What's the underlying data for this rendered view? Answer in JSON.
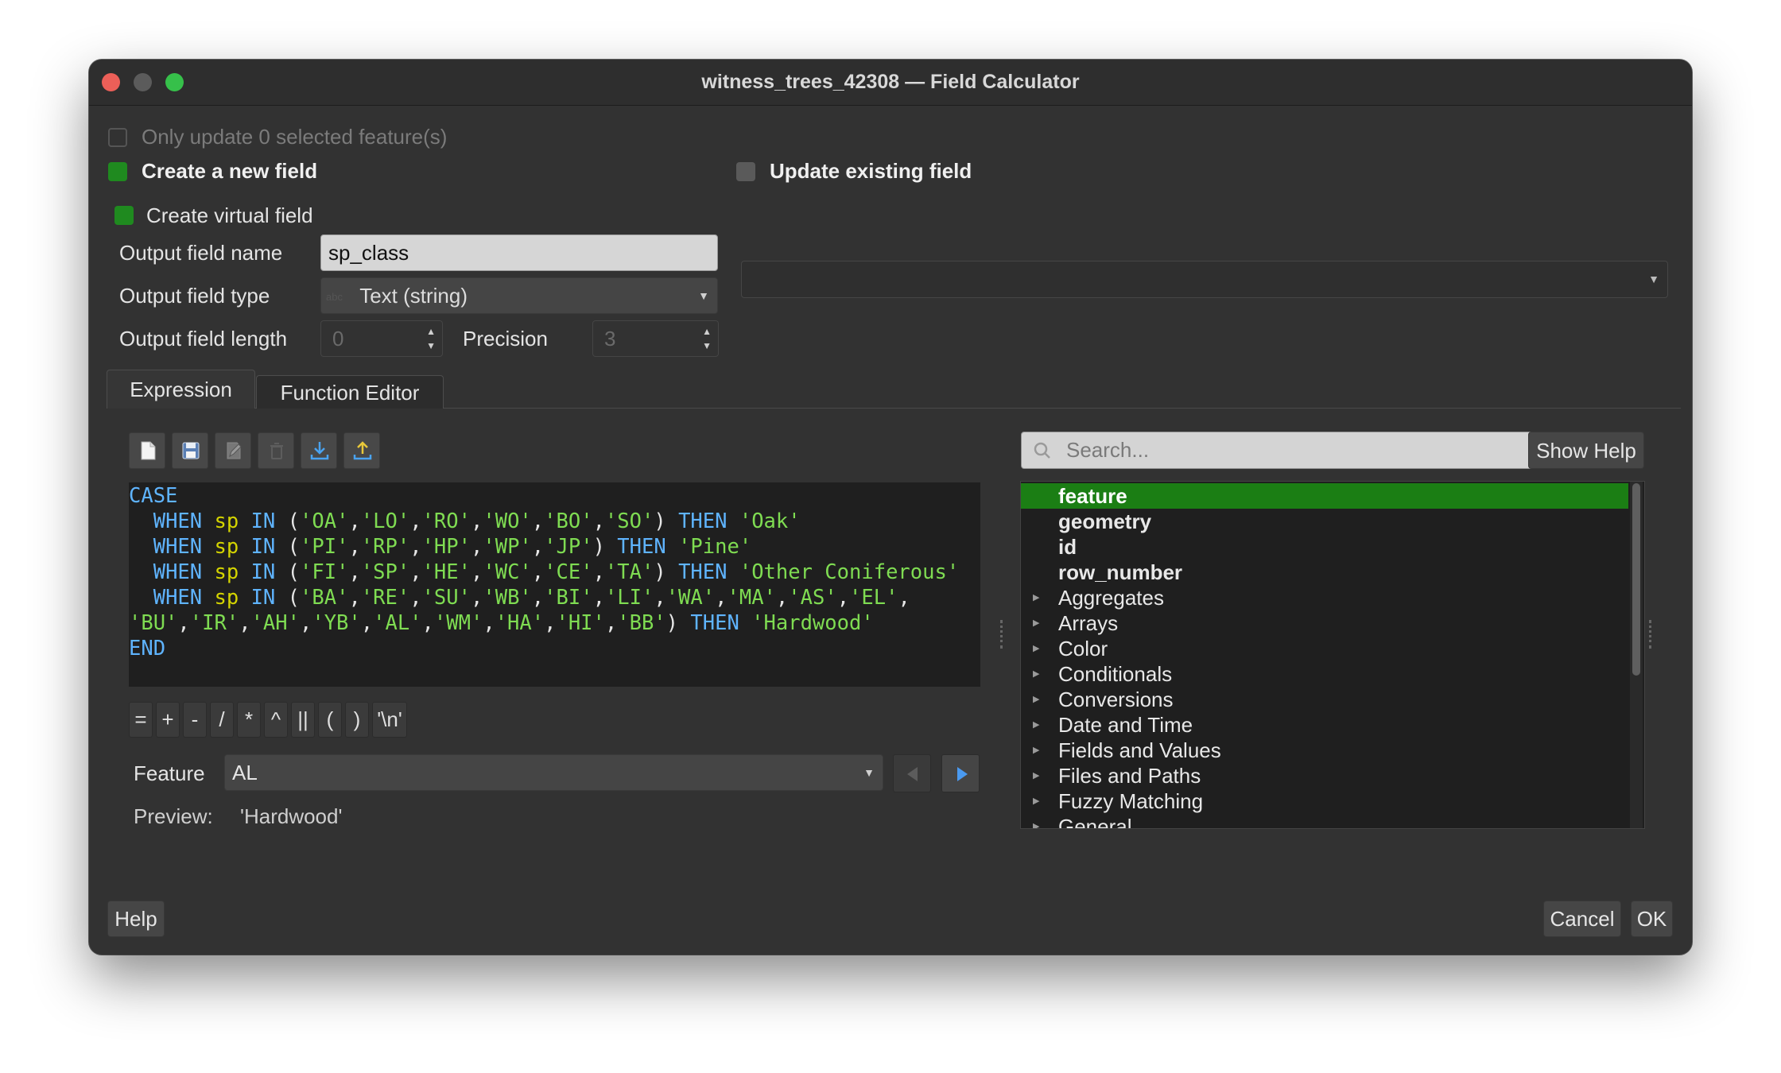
{
  "window": {
    "title": "witness_trees_42308 — Field Calculator",
    "traffic_lights": {
      "close": "#ec5f58",
      "minimize": "#5b5b5b",
      "zoom": "#36c04a"
    }
  },
  "options": {
    "only_update_label": "Only update 0 selected feature(s)",
    "create_new_field_label": "Create a new field",
    "update_existing_label": "Update existing field",
    "virtual_field_label": "Create virtual field",
    "output_name_label": "Output field name",
    "output_name_value": "sp_class",
    "output_type_label": "Output field type",
    "output_type_icon": "abc",
    "output_type_value": "Text (string)",
    "output_length_label": "Output field length",
    "output_length_value": "0",
    "precision_label": "Precision",
    "precision_value": "3",
    "existing_field_value": ""
  },
  "tabs": [
    {
      "label": "Expression",
      "active": true
    },
    {
      "label": "Function Editor",
      "active": false
    }
  ],
  "toolbar_icons": [
    "new-file-icon",
    "save-icon",
    "edit-icon",
    "delete-icon",
    "import-icon",
    "export-icon"
  ],
  "editor": {
    "lines": [
      [
        [
          "CASE",
          "kw"
        ]
      ],
      [
        [
          "  ",
          ""
        ],
        [
          "WHEN",
          "kw"
        ],
        [
          " ",
          ""
        ],
        [
          "sp",
          "fld"
        ],
        [
          " ",
          ""
        ],
        [
          "IN",
          "kw"
        ],
        [
          " (",
          ""
        ],
        [
          "'OA'",
          "str"
        ],
        [
          ",",
          ""
        ],
        [
          "'LO'",
          "str"
        ],
        [
          ",",
          ""
        ],
        [
          "'RO'",
          "str"
        ],
        [
          ",",
          ""
        ],
        [
          "'WO'",
          "str"
        ],
        [
          ",",
          ""
        ],
        [
          "'BO'",
          "str"
        ],
        [
          ",",
          ""
        ],
        [
          "'SO'",
          "str"
        ],
        [
          ") ",
          ""
        ],
        [
          "THEN",
          "kw"
        ],
        [
          " ",
          ""
        ],
        [
          "'Oak'",
          "str"
        ]
      ],
      [
        [
          "  ",
          ""
        ],
        [
          "WHEN",
          "kw"
        ],
        [
          " ",
          ""
        ],
        [
          "sp",
          "fld"
        ],
        [
          " ",
          ""
        ],
        [
          "IN",
          "kw"
        ],
        [
          " (",
          ""
        ],
        [
          "'PI'",
          "str"
        ],
        [
          ",",
          ""
        ],
        [
          "'RP'",
          "str"
        ],
        [
          ",",
          ""
        ],
        [
          "'HP'",
          "str"
        ],
        [
          ",",
          ""
        ],
        [
          "'WP'",
          "str"
        ],
        [
          ",",
          ""
        ],
        [
          "'JP'",
          "str"
        ],
        [
          ") ",
          ""
        ],
        [
          "THEN",
          "kw"
        ],
        [
          " ",
          ""
        ],
        [
          "'Pine'",
          "str"
        ]
      ],
      [
        [
          "  ",
          ""
        ],
        [
          "WHEN",
          "kw"
        ],
        [
          " ",
          ""
        ],
        [
          "sp",
          "fld"
        ],
        [
          " ",
          ""
        ],
        [
          "IN",
          "kw"
        ],
        [
          " (",
          ""
        ],
        [
          "'FI'",
          "str"
        ],
        [
          ",",
          ""
        ],
        [
          "'SP'",
          "str"
        ],
        [
          ",",
          ""
        ],
        [
          "'HE'",
          "str"
        ],
        [
          ",",
          ""
        ],
        [
          "'WC'",
          "str"
        ],
        [
          ",",
          ""
        ],
        [
          "'CE'",
          "str"
        ],
        [
          ",",
          ""
        ],
        [
          "'TA'",
          "str"
        ],
        [
          ") ",
          ""
        ],
        [
          "THEN",
          "kw"
        ],
        [
          " ",
          ""
        ],
        [
          "'Other Coniferous'",
          "str"
        ]
      ],
      [
        [
          "  ",
          ""
        ],
        [
          "WHEN",
          "kw"
        ],
        [
          " ",
          ""
        ],
        [
          "sp",
          "fld"
        ],
        [
          " ",
          ""
        ],
        [
          "IN",
          "kw"
        ],
        [
          " (",
          ""
        ],
        [
          "'BA'",
          "str"
        ],
        [
          ",",
          ""
        ],
        [
          "'RE'",
          "str"
        ],
        [
          ",",
          ""
        ],
        [
          "'SU'",
          "str"
        ],
        [
          ",",
          ""
        ],
        [
          "'WB'",
          "str"
        ],
        [
          ",",
          ""
        ],
        [
          "'BI'",
          "str"
        ],
        [
          ",",
          ""
        ],
        [
          "'LI'",
          "str"
        ],
        [
          ",",
          ""
        ],
        [
          "'WA'",
          "str"
        ],
        [
          ",",
          ""
        ],
        [
          "'MA'",
          "str"
        ],
        [
          ",",
          ""
        ],
        [
          "'AS'",
          "str"
        ],
        [
          ",",
          ""
        ],
        [
          "'EL'",
          "str"
        ],
        [
          ",",
          ""
        ]
      ],
      [
        [
          "'BU'",
          "str"
        ],
        [
          ",",
          ""
        ],
        [
          "'IR'",
          "str"
        ],
        [
          ",",
          ""
        ],
        [
          "'AH'",
          "str"
        ],
        [
          ",",
          ""
        ],
        [
          "'YB'",
          "str"
        ],
        [
          ",",
          ""
        ],
        [
          "'AL'",
          "str"
        ],
        [
          ",",
          ""
        ],
        [
          "'WM'",
          "str"
        ],
        [
          ",",
          ""
        ],
        [
          "'HA'",
          "str"
        ],
        [
          ",",
          ""
        ],
        [
          "'HI'",
          "str"
        ],
        [
          ",",
          ""
        ],
        [
          "'BB'",
          "str"
        ],
        [
          ") ",
          ""
        ],
        [
          "THEN",
          "kw"
        ],
        [
          " ",
          ""
        ],
        [
          "'Hardwood'",
          "str"
        ]
      ],
      [
        [
          "END",
          "kw"
        ]
      ]
    ]
  },
  "operators": [
    "=",
    "+",
    "-",
    "/",
    "*",
    "^",
    "||",
    "(",
    ")",
    "'\\n'"
  ],
  "feature": {
    "label": "Feature",
    "value": "AL",
    "prev_icon": "left-triangle-icon",
    "next_icon": "right-triangle-icon"
  },
  "preview": {
    "label": "Preview:",
    "value": "'Hardwood'"
  },
  "search": {
    "placeholder": "Search...",
    "show_help": "Show Help"
  },
  "function_tree": [
    {
      "label": "feature",
      "bold": true,
      "selected": true,
      "expandable": false
    },
    {
      "label": "geometry",
      "bold": true,
      "selected": false,
      "expandable": false
    },
    {
      "label": "id",
      "bold": true,
      "selected": false,
      "expandable": false
    },
    {
      "label": "row_number",
      "bold": true,
      "selected": false,
      "expandable": false
    },
    {
      "label": "Aggregates",
      "bold": false,
      "selected": false,
      "expandable": true
    },
    {
      "label": "Arrays",
      "bold": false,
      "selected": false,
      "expandable": true
    },
    {
      "label": "Color",
      "bold": false,
      "selected": false,
      "expandable": true
    },
    {
      "label": "Conditionals",
      "bold": false,
      "selected": false,
      "expandable": true
    },
    {
      "label": "Conversions",
      "bold": false,
      "selected": false,
      "expandable": true
    },
    {
      "label": "Date and Time",
      "bold": false,
      "selected": false,
      "expandable": true
    },
    {
      "label": "Fields and Values",
      "bold": false,
      "selected": false,
      "expandable": true
    },
    {
      "label": "Files and Paths",
      "bold": false,
      "selected": false,
      "expandable": true
    },
    {
      "label": "Fuzzy Matching",
      "bold": false,
      "selected": false,
      "expandable": true
    },
    {
      "label": "General",
      "bold": false,
      "selected": false,
      "expandable": true
    }
  ],
  "buttons": {
    "help": "Help",
    "cancel": "Cancel",
    "ok": "OK"
  },
  "colors": {
    "accent_green": "#1f8a1f",
    "selection_green": "#1b7e14",
    "keyword": "#5fb4ff",
    "string": "#7fdc52",
    "field": "#d4d400"
  }
}
